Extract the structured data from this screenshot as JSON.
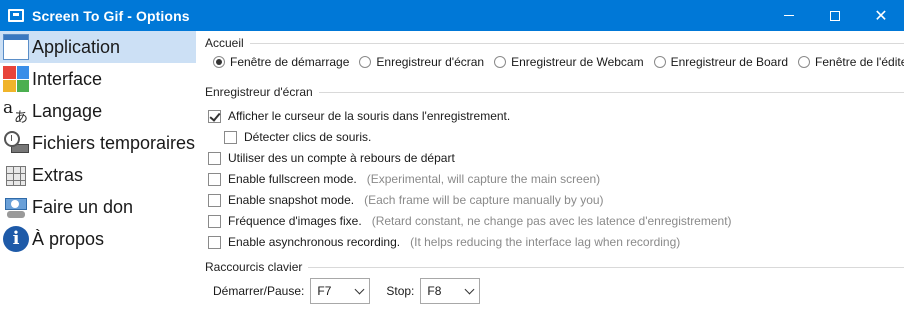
{
  "window": {
    "title": "Screen To Gif - Options",
    "minimize_glyph": "",
    "maximize_glyph": "",
    "close_glyph": "✕"
  },
  "sidebar": {
    "items": [
      {
        "label": "Application",
        "icon": "application-window-icon",
        "selected": true
      },
      {
        "label": "Interface",
        "icon": "color-palette-icon",
        "selected": false
      },
      {
        "label": "Langage",
        "icon": "language-icon",
        "selected": false
      },
      {
        "label": "Fichiers temporaires",
        "icon": "temp-files-clock-icon",
        "selected": false
      },
      {
        "label": "Extras",
        "icon": "extras-cube-icon",
        "selected": false
      },
      {
        "label": "Faire un don",
        "icon": "donate-money-icon",
        "selected": false
      },
      {
        "label": "À propos",
        "icon": "info-icon",
        "selected": false
      }
    ]
  },
  "accueil": {
    "title": "Accueil",
    "options": [
      {
        "label": "Fenêtre de démarrage",
        "checked": true
      },
      {
        "label": "Enregistreur d'écran",
        "checked": false
      },
      {
        "label": "Enregistreur de Webcam",
        "checked": false
      },
      {
        "label": "Enregistreur de Board",
        "checked": false
      },
      {
        "label": "Fenêtre de l'éditeu",
        "checked": false
      }
    ]
  },
  "recorder": {
    "title": "Enregistreur d'écran",
    "options": [
      {
        "label": "Afficher le curseur de la souris dans l'enregistrement.",
        "hint": "",
        "checked": true
      },
      {
        "label": "Détecter clics de souris.",
        "hint": "",
        "checked": false
      },
      {
        "label": "Utiliser des un compte à rebours de départ",
        "hint": "",
        "checked": false
      },
      {
        "label": "Enable fullscreen mode.",
        "hint": "(Experimental, will capture the main screen)",
        "checked": false
      },
      {
        "label": "Enable snapshot mode.",
        "hint": "(Each frame will be capture manually by you)",
        "checked": false
      },
      {
        "label": "Fréquence d'images fixe.",
        "hint": "(Retard constant, ne change pas avec les latence d'enregistrement)",
        "checked": false
      },
      {
        "label": "Enable asynchronous recording.",
        "hint": "(It helps reducing the interface lag when recording)",
        "checked": false
      }
    ]
  },
  "shortcuts": {
    "title": "Raccourcis clavier",
    "start_pause_label": "Démarrer/Pause:",
    "start_pause_value": "F7",
    "stop_label": "Stop:",
    "stop_value": "F8"
  },
  "colors": {
    "titlebar": "#0078d7",
    "selected_nav": "#cce0f5",
    "hint_text": "#8a8a8a"
  }
}
